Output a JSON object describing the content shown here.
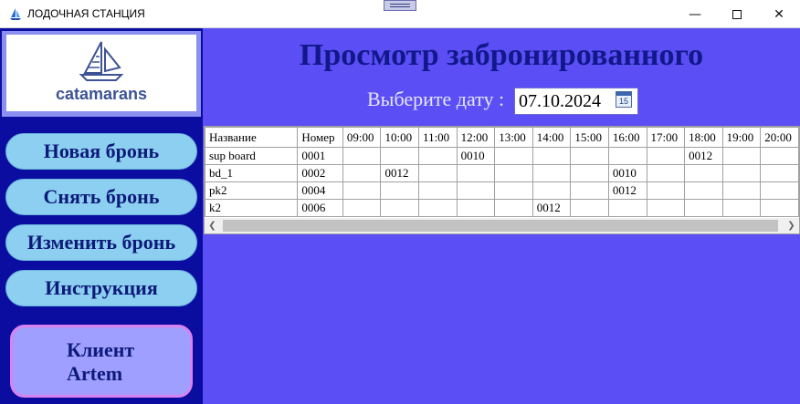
{
  "window": {
    "title": "ЛОДОЧНАЯ СТАНЦИЯ",
    "min_icon": "minimize-icon",
    "max_icon": "maximize-icon",
    "close_icon": "close-icon"
  },
  "sidebar": {
    "logo_text": "catamarans",
    "buttons": {
      "new": "Новая бронь",
      "cancel": "Снять бронь",
      "edit": "Изменить бронь",
      "help": "Инструкция"
    },
    "client": {
      "label": "Клиент",
      "name": "Artem"
    }
  },
  "main": {
    "title": "Просмотр забронированного",
    "date_label": "Выберите дату :",
    "date_value": "07.10.2024",
    "calendar_icon_text": "15"
  },
  "grid": {
    "columns": [
      "Название",
      "Номер",
      "09:00",
      "10:00",
      "11:00",
      "12:00",
      "13:00",
      "14:00",
      "15:00",
      "16:00",
      "17:00",
      "18:00",
      "19:00",
      "20:00"
    ],
    "rows": [
      [
        "sup board",
        "0001",
        "",
        "",
        "",
        "0010",
        "",
        "",
        "",
        "",
        "",
        "0012",
        "",
        ""
      ],
      [
        "bd_1",
        "0002",
        "",
        "0012",
        "",
        "",
        "",
        "",
        "",
        "0010",
        "",
        "",
        "",
        ""
      ],
      [
        "pk2",
        "0004",
        "",
        "",
        "",
        "",
        "",
        "",
        "",
        "0012",
        "",
        "",
        "",
        ""
      ],
      [
        "k2",
        "0006",
        "",
        "",
        "",
        "",
        "",
        "0012",
        "",
        "",
        "",
        "",
        "",
        ""
      ]
    ]
  },
  "colors": {
    "background": "#5b4ef5",
    "sidebar": "#0b0da0",
    "button": "#8ccff0",
    "client_card": "#9f9fff",
    "title": "#10188a"
  }
}
